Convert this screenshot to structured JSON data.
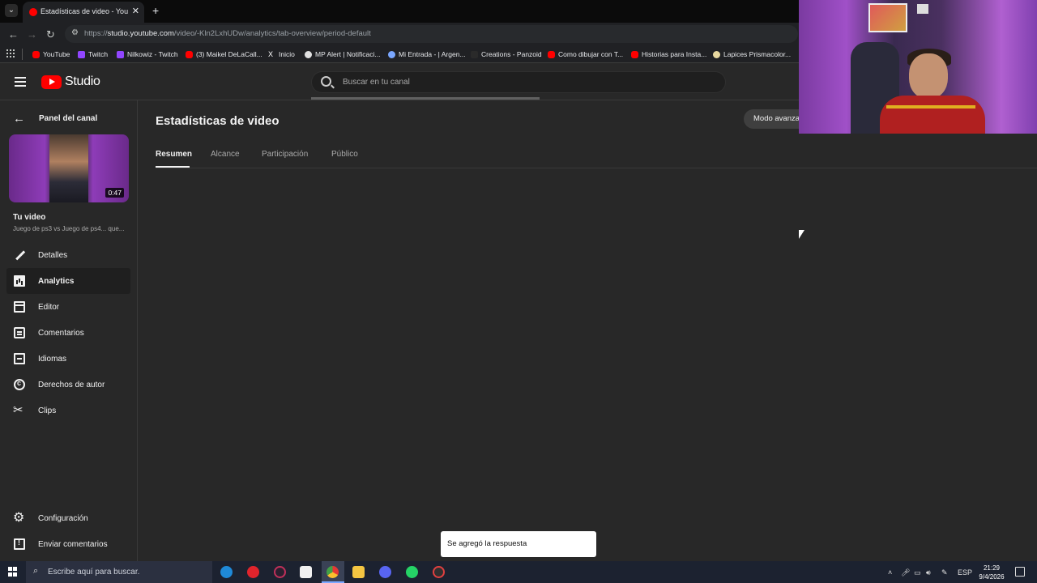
{
  "browser": {
    "tab_title": "Estadísticas de video - YouTube Studio",
    "tab_close": "✕",
    "new_tab": "+",
    "url_prefix": "https://",
    "url_host": "studio.youtube.com",
    "url_path": "/video/-Kln2LxhUDw/analytics/tab-overview/period-default",
    "bookmarks": [
      {
        "label": "YouTube",
        "color": "#ff0000"
      },
      {
        "label": "Twitch",
        "color": "#9146ff"
      },
      {
        "label": "Nilkowiz - Twitch",
        "color": "#9146ff"
      },
      {
        "label": "(3) Maikel DeLaCall...",
        "color": "#ff0000"
      },
      {
        "label": "Inicio",
        "color": "#ffffff"
      },
      {
        "label": "MP Alert | Notificaci...",
        "color": "#e0e0e0"
      },
      {
        "label": "Mi Entrada - | Argen...",
        "color": "#7aa7ff"
      },
      {
        "label": "Creations - Panzoid",
        "color": "#2a2a2a"
      },
      {
        "label": "Como dibujar con T...",
        "color": "#ff0000"
      },
      {
        "label": "Historias para Insta...",
        "color": "#ff0000"
      },
      {
        "label": "Lapices Prismacolor...",
        "color": "#e8d8a0"
      }
    ]
  },
  "header": {
    "logo_text": "Studio",
    "search_placeholder": "Buscar en tu canal"
  },
  "sidebar": {
    "back_label": "Panel del canal",
    "video_duration": "0:47",
    "video_title": "Tu video",
    "video_subtitle": "Juego de ps3 vs Juego de ps4... que...",
    "items": [
      {
        "label": "Detalles"
      },
      {
        "label": "Analytics"
      },
      {
        "label": "Editor"
      },
      {
        "label": "Comentarios"
      },
      {
        "label": "Idiomas"
      },
      {
        "label": "Derechos de autor"
      },
      {
        "label": "Clips"
      }
    ],
    "bottom_items": [
      {
        "label": "Configuración"
      },
      {
        "label": "Enviar comentarios"
      }
    ]
  },
  "main": {
    "page_title": "Estadísticas de video",
    "advanced_mode": "Modo avanzado",
    "tabs": [
      {
        "label": "Resumen"
      },
      {
        "label": "Alcance"
      },
      {
        "label": "Participación"
      },
      {
        "label": "Público"
      }
    ]
  },
  "toast": {
    "message": "Se agregó la respuesta"
  },
  "taskbar": {
    "search_placeholder": "Escribe aquí para buscar.",
    "language": "ESP",
    "time": "21:29",
    "date": "9/4/2026"
  }
}
